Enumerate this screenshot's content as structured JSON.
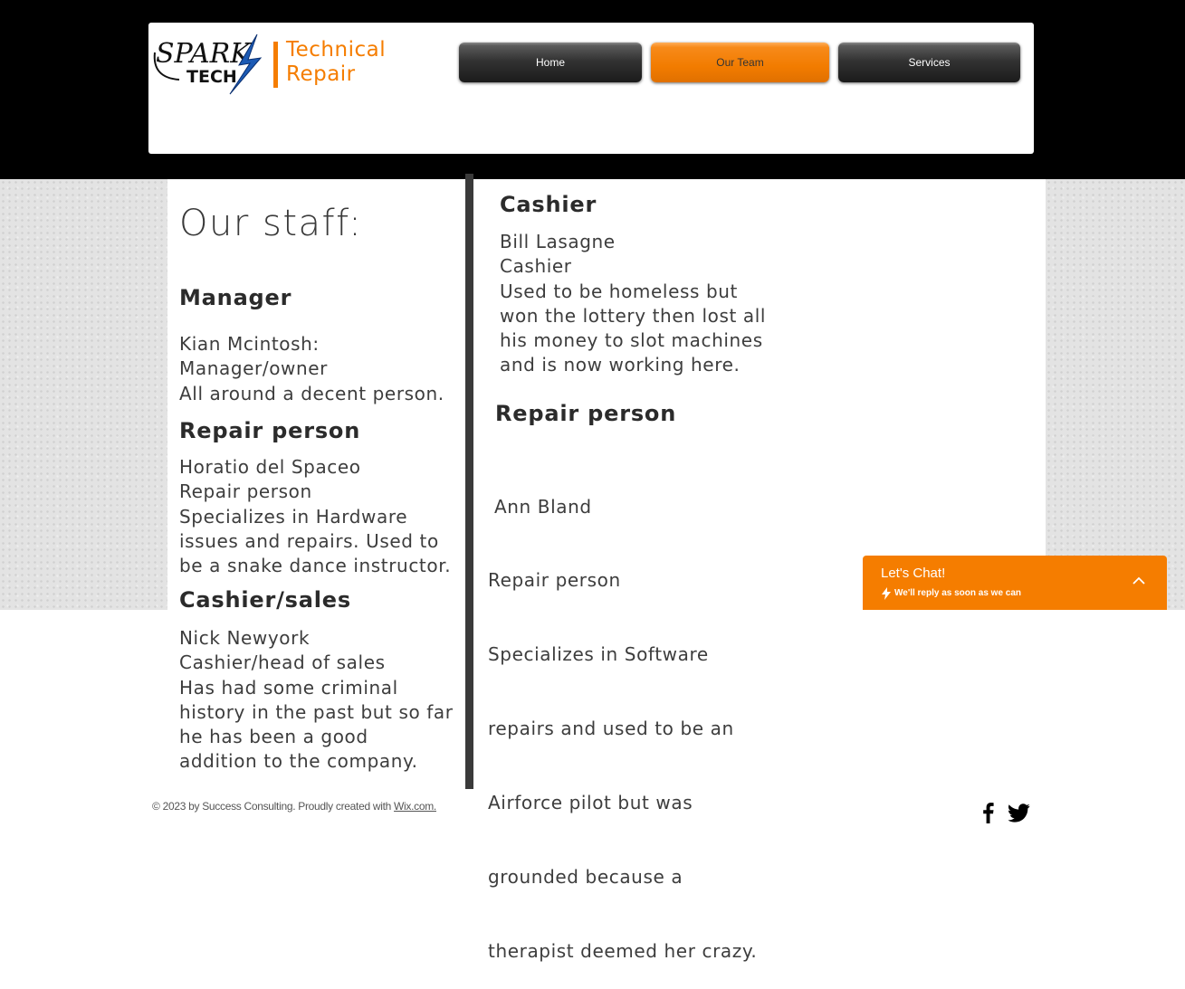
{
  "header": {
    "title_line1": "Technical",
    "title_line2": "Repair",
    "logo_text_1": "SPARK",
    "logo_text_2": "TECH"
  },
  "nav": {
    "items": [
      {
        "label": "Home",
        "active": false
      },
      {
        "label": "Our Team",
        "active": true
      },
      {
        "label": "Services",
        "active": false
      }
    ]
  },
  "main": {
    "heading": "Our staff:",
    "left": {
      "manager": {
        "heading": "Manager",
        "lines": [
          "Kian Mcintosh:",
          "Manager/owner",
          "All around a decent person."
        ]
      },
      "repair": {
        "heading": "Repair person",
        "lines": [
          "Horatio del Spaceo",
          "Repair person",
          "Specializes in Hardware",
          "issues and repairs. Used to",
          "be a snake dance instructor."
        ]
      },
      "cashier_sales": {
        "heading": "Cashier/sales",
        "lines": [
          "Nick Newyork",
          "Cashier/head of sales",
          "Has had some criminal",
          "history in the past but so far",
          "he has been a good",
          "addition to the company."
        ]
      }
    },
    "right": {
      "cashier": {
        "heading": "Cashier",
        "lines": [
          "Bill Lasagne",
          "Cashier",
          "Used to be homeless but",
          "won the lottery then lost all",
          "his money to slot machines",
          "and is now working here."
        ]
      },
      "repair": {
        "heading": "Repair person",
        "lines": [
          " Ann Bland",
          "Repair person",
          "Specializes in Software",
          "repairs and used to be an",
          "Airforce pilot but was",
          "grounded because a",
          "therapist deemed her crazy."
        ]
      }
    }
  },
  "chat": {
    "title": "Let's Chat!",
    "subtitle": "We'll reply as soon as we can"
  },
  "footer": {
    "text": "© 2023 by Success Consulting. Proudly created with ",
    "link": "Wix.com."
  },
  "social": [
    "facebook-icon",
    "twitter-icon"
  ],
  "colors": {
    "accent": "#f57d00",
    "header_bg": "#000000",
    "text": "#3a3a3a"
  }
}
